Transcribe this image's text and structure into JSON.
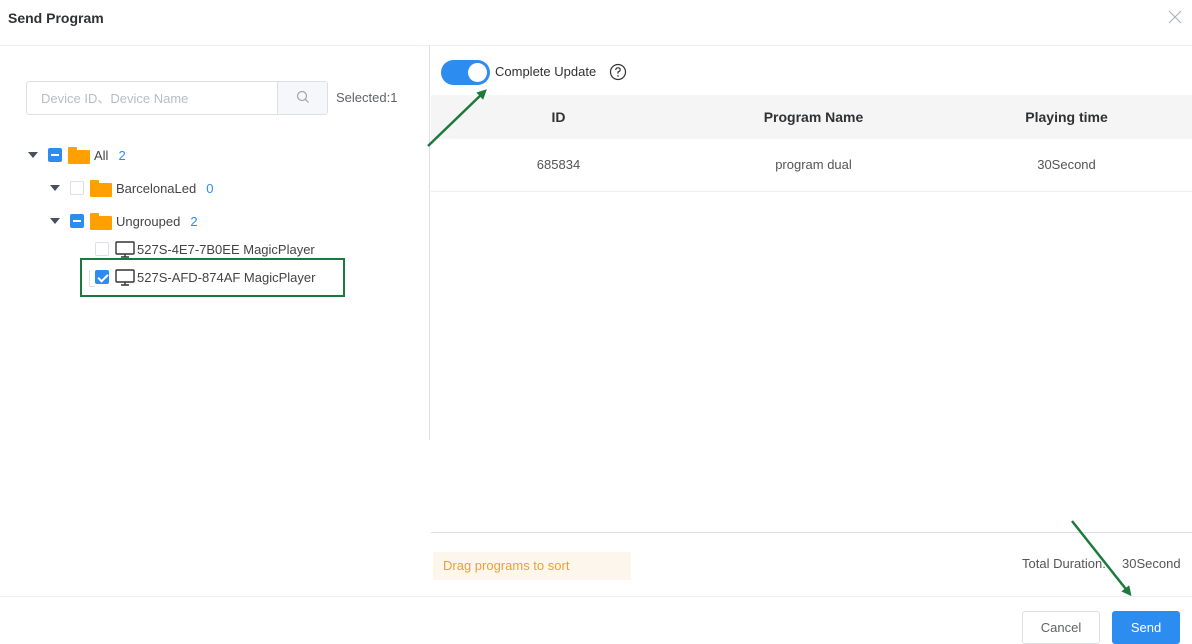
{
  "dialog": {
    "title": "Send Program",
    "close_icon": "close-icon"
  },
  "search": {
    "placeholder": "Device ID、Device Name",
    "value": "",
    "icon": "search-icon",
    "selected_text": "Selected:1"
  },
  "tree": {
    "root": {
      "label": "All",
      "count": "2",
      "state": "indeterminate",
      "expanded": true
    },
    "groups": [
      {
        "label": "BarcelonaLed",
        "count": "0",
        "state": "unchecked",
        "expanded": true
      },
      {
        "label": "Ungrouped",
        "count": "2",
        "state": "indeterminate",
        "expanded": true
      }
    ],
    "devices": [
      {
        "label": "527S-4E7-7B0EE MagicPlayer",
        "checked": false,
        "icon": "monitor-icon"
      },
      {
        "label": "527S-AFD-874AF MagicPlayer",
        "checked": true,
        "icon": "monitor-icon"
      }
    ]
  },
  "options": {
    "complete_update_label": "Complete Update",
    "complete_update_on": true,
    "help_icon": "help-icon"
  },
  "table": {
    "headers": [
      "ID",
      "Program Name",
      "Playing time"
    ],
    "rows": [
      [
        "685834",
        "program dual",
        "30Second"
      ]
    ]
  },
  "footer": {
    "drag_hint": "Drag programs to sort",
    "total_label": "Total Duration:",
    "total_value": "30Second",
    "cancel_label": "Cancel",
    "send_label": "Send"
  },
  "colors": {
    "primary": "#2d8cf0",
    "folder": "#ff9f00",
    "annotation": "#1d7a3c",
    "hint_bg": "#fdf6ec",
    "hint_text": "#e6a23c"
  }
}
